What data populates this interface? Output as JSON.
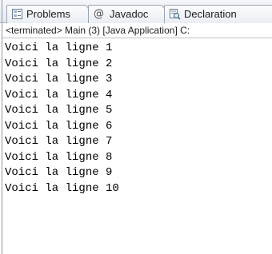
{
  "tabs": [
    {
      "label": "Problems",
      "icon": "problems-icon"
    },
    {
      "label": "Javadoc",
      "icon": "javadoc-icon",
      "glyph": "@"
    },
    {
      "label": "Declaration",
      "icon": "declaration-icon"
    }
  ],
  "status": {
    "text": "<terminated> Main (3) [Java Application] C:"
  },
  "console": {
    "lines": [
      "Voici la ligne 1",
      "Voici la ligne 2",
      "Voici la ligne 3",
      "Voici la ligne 4",
      "Voici la ligne 5",
      "Voici la ligne 6",
      "Voici la ligne 7",
      "Voici la ligne 8",
      "Voici la ligne 9",
      "Voici la ligne 10"
    ]
  }
}
